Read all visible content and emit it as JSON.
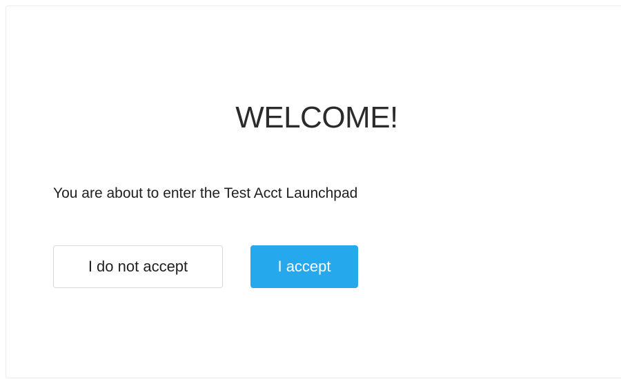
{
  "dialog": {
    "title": "WELCOME!",
    "message": "You are about to enter the Test Acct Launchpad",
    "decline_label": "I do not accept",
    "accept_label": "I accept"
  },
  "colors": {
    "accent": "#26a8ec",
    "text": "#1f1f1f",
    "border": "#d7d7d7"
  }
}
